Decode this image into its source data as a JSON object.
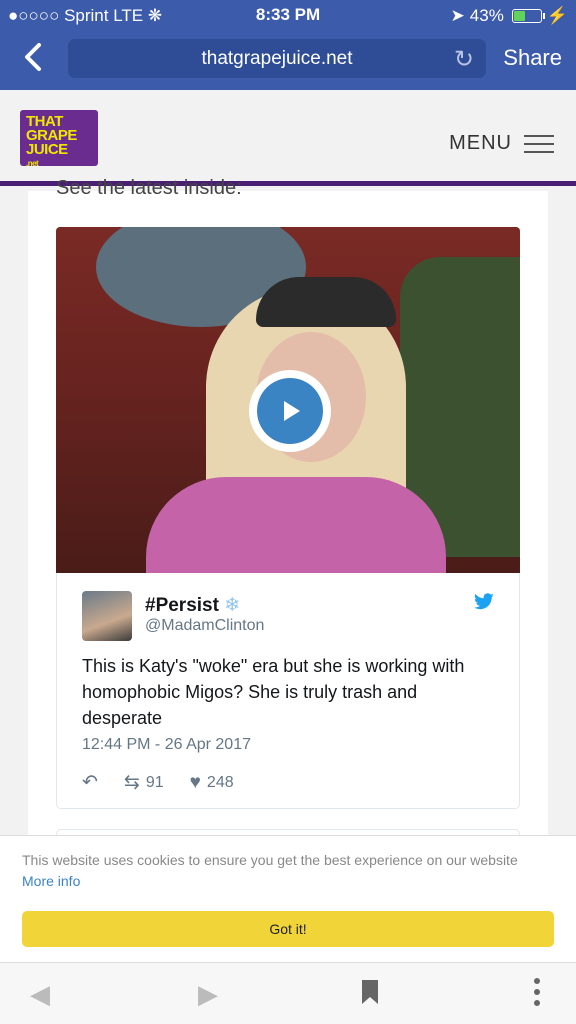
{
  "status_bar": {
    "carrier": "●○○○○ Sprint",
    "network": "LTE",
    "time": "8:33 PM",
    "battery_pct": "43%",
    "battery_level": 0.43
  },
  "browser": {
    "url": "thatgrapejuice.net",
    "share_label": "Share",
    "back_icon": "chevron-left-icon",
    "reload_icon": "reload-icon"
  },
  "site": {
    "logo_lines": [
      "THAT",
      "GRAPE",
      "JUICE"
    ],
    "logo_suffix": ".net",
    "menu_label": "MENU"
  },
  "article": {
    "cut_text": "See the latest inside:"
  },
  "tweet": {
    "name": "#Persist",
    "name_emoji": "❄",
    "handle": "@MadamClinton",
    "text": "This is Katy's \"woke\" era but she is working with homophobic Migos? She is truly trash and desperate",
    "date": "12:44 PM - 26 Apr 2017",
    "retweets": "91",
    "likes": "248"
  },
  "cookie": {
    "message": "This website uses cookies to ensure you get the best experience on our website",
    "more_info": "More info",
    "button": "Got it!"
  },
  "colors": {
    "browser_bar": "#3d5bab",
    "brand_purple": "#6b2c8f",
    "cookie_button": "#f1d438",
    "twitter_blue": "#1da1f2"
  }
}
